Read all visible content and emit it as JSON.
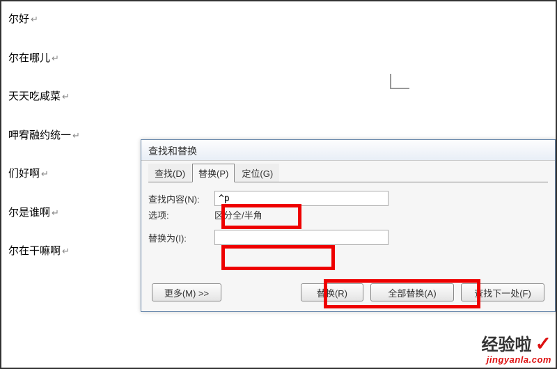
{
  "doc_lines": [
    "尔好",
    "尔在哪儿",
    "天天吃咸菜",
    "呷宥融约统一",
    "们好啊",
    "尔是谁啊",
    "尔在干嘛啊"
  ],
  "dialog": {
    "title": "查找和替换",
    "tabs": {
      "find": "查找(D)",
      "replace": "替换(P)",
      "goto": "定位(G)"
    },
    "labels": {
      "find_what": "查找内容(N):",
      "options": "选项:",
      "replace_with": "替换为(I):"
    },
    "values": {
      "find": "^p",
      "replace": "",
      "option_text": "区分全/半角"
    },
    "buttons": {
      "more": "更多(M) >>",
      "replace": "替换(R)",
      "replace_all": "全部替换(A)",
      "find_next": "查找下一处(F)"
    }
  },
  "watermark": {
    "line1": "经验啦",
    "check": "✓",
    "line2": "jingyanla.com"
  }
}
